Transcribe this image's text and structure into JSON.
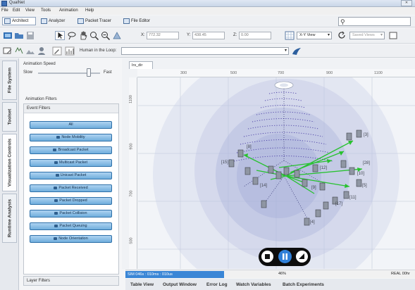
{
  "window": {
    "title": "QualNet"
  },
  "menu": [
    "File",
    "Edit",
    "View",
    "Tools",
    "Animation",
    "Help"
  ],
  "mode_tabs": [
    {
      "label": "Architect",
      "icon": "architect-icon"
    },
    {
      "label": "Analyzer",
      "icon": "analyzer-icon"
    },
    {
      "label": "Packet Tracer",
      "icon": "packet-tracer-icon"
    },
    {
      "label": "File Editor",
      "icon": "file-editor-icon"
    }
  ],
  "coords": {
    "x_label": "X:",
    "x_value": "772.32",
    "y_label": "Y:",
    "y_value": "438.45",
    "z_label": "Z:",
    "z_value": "0.00"
  },
  "view_select": "X-Y View",
  "saved_views": "Saved Views",
  "human_in_loop": {
    "label": "Human in the Loop:",
    "value": ""
  },
  "side_tabs": [
    "File System",
    "Toolset",
    "Visualization Controls",
    "Runtime Analysis"
  ],
  "animation": {
    "label": "Animation Speed",
    "slow": "Slow",
    "fast": "Fast",
    "speed_fraction": 0.82
  },
  "filters": {
    "title": "Animation Filters",
    "event_head": "Event Filters",
    "buttons": [
      "All",
      "Node Mobility",
      "Broadcast Packet",
      "Multicast Packet",
      "Unicast Packet",
      "Packet Received",
      "Packet Dropped",
      "Packet Collision",
      "Packet Queuing",
      "Node Orientation"
    ],
    "layer_filters": "Layer Filters"
  },
  "canvas": {
    "tab": "Irs_dir",
    "top_ticks": [
      "300",
      "500",
      "700",
      "900",
      "1100"
    ],
    "left_ticks": [
      "1100",
      "900",
      "700",
      "500"
    ],
    "node_labels": [
      "[3]",
      "[8]",
      "[15]",
      "[14]",
      "[12]",
      "[10]",
      "[28]",
      "[5]",
      "[11]",
      "[17]",
      "[9]",
      "[4]"
    ]
  },
  "status": {
    "sim_time": "SIM 046s : 010ms : 010us",
    "progress_pct": "46%",
    "progress_fraction": 0.46,
    "real_time": "REAL 00hr"
  },
  "bottom_tabs": [
    "Table View",
    "Output Window",
    "Error Log",
    "Watch Variables",
    "Batch Experiments"
  ],
  "colors": {
    "accent": "#3a86d6",
    "link_green": "#27c22f",
    "filter_button": "#8cc1ea"
  }
}
